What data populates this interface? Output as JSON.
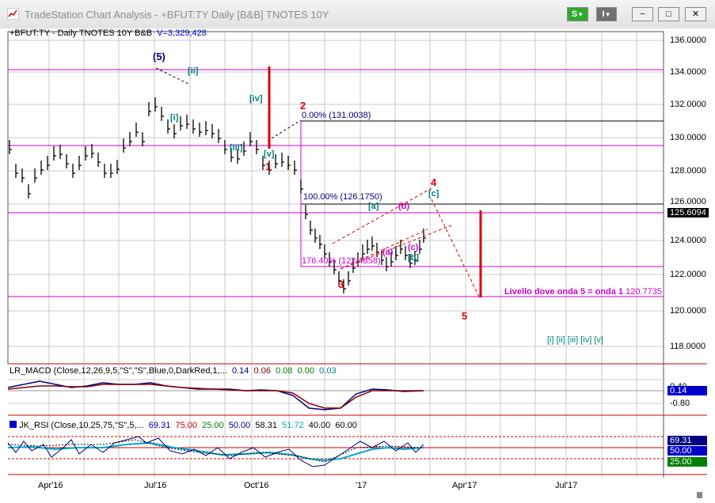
{
  "window": {
    "title": "TradeStation Chart Analysis - +BFUT:TY Daily [B&B] TNOTES 10Y",
    "s_button": "S",
    "i_button": "I",
    "minimize": "−",
    "restore": "□",
    "close": "✕"
  },
  "price_panel": {
    "header": "+BFUT:TY - Daily  TNOTES 10Y  B&B",
    "volume": "V=3,329,428",
    "axis_labels": [
      "136.0000",
      "134.0000",
      "132.0000",
      "130.0000",
      "128.0000",
      "126.0000",
      "124.0000",
      "122.0000",
      "120.0000",
      "118.0000"
    ],
    "last_price": "125.6094",
    "wave_labels": {
      "w5_top": "(5)",
      "wii": "[ii]",
      "wi": "[i]",
      "wiv": "[iv]",
      "wiii": "[iii]",
      "wv": "[v]",
      "w1": "1",
      "w2": "2",
      "w3": "3",
      "w4": "4",
      "w5": "5",
      "wa_small": "[a]",
      "wb_paren": "(b)",
      "wa_paren": "(a)",
      "wc_paren": "(c)",
      "wb_br": "[b]",
      "wc_br": "[c]"
    },
    "fib_0": "0.00% (131.0038)",
    "fib_100": "100.00% (126.1750)",
    "fib_176": "176.40% (122.4858)",
    "note": "Livello dove onda 5 = onda 1",
    "note_value": "120.7735",
    "legend_waves": [
      "[i]",
      "[ii]",
      "[iii]",
      "[iv]",
      "[v]"
    ]
  },
  "macd_panel": {
    "name": "LR_MACD (Close,12,26,9,5,\"S\",\"S\",Blue,0,DarkRed,1,...",
    "vals": [
      "0.14",
      "0.06",
      "0.08",
      "0.00",
      "0.03"
    ],
    "axis_top": "0.40",
    "axis_val": "0.14",
    "axis_bottom": "-0.80"
  },
  "rsi_panel": {
    "name": "JK_RSI (Close,10,25,75,\"S\",5,...",
    "vals": [
      "69.31",
      "75.00",
      "25.00",
      "50.00",
      "58.31",
      "51.72",
      "40.00",
      "60.00"
    ],
    "axis": [
      "69.31",
      "50.00",
      "25.00"
    ]
  },
  "date_axis": [
    "Apr'16",
    "Jul'16",
    "Oct'16",
    "'17",
    "Apr'17",
    "Jul'17"
  ],
  "colors": {
    "magenta": "#cc00cc",
    "red": "#dd0000",
    "teal": "#008080",
    "navy": "#000080"
  }
}
